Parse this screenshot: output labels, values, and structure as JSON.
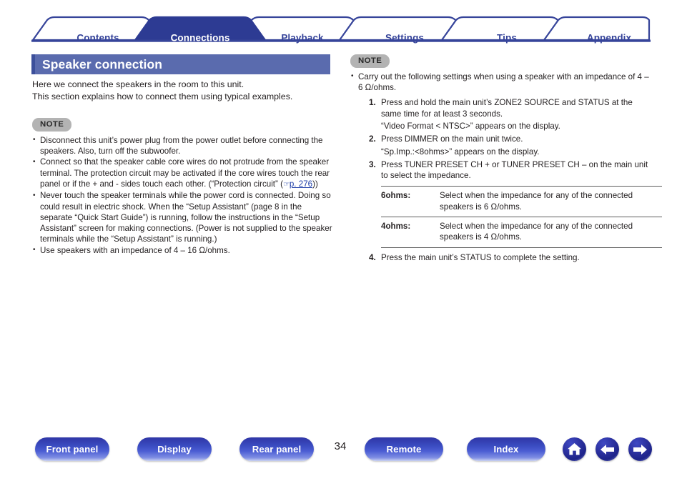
{
  "tabs": [
    {
      "label": "Contents",
      "active": false
    },
    {
      "label": "Connections",
      "active": true
    },
    {
      "label": "Playback",
      "active": false
    },
    {
      "label": "Settings",
      "active": false
    },
    {
      "label": "Tips",
      "active": false
    },
    {
      "label": "Appendix",
      "active": false
    }
  ],
  "page": {
    "title": "Speaker connection",
    "number": "34"
  },
  "left": {
    "intro": [
      "Here we connect the speakers in the room to this unit.",
      "This section explains how to connect them using typical examples."
    ],
    "note_label": "NOTE",
    "notes": [
      "Disconnect this unit’s power plug from the power outlet before connecting the speakers. Also, turn off the subwoofer.",
      "Connect so that the speaker cable core wires do not protrude from the speaker terminal. The protection circuit may be activated if the core wires touch the rear panel or if the + and - sides touch each other. (“Protection circuit” (",
      "Never touch the speaker terminals while the power cord is connected. Doing so could result in electric shock. When the “Setup Assistant” (page 8 in the separate “Quick Start Guide”) is running, follow the instructions in the “Setup Assistant” screen for making connections. (Power is not supplied to the speaker terminals while the “Setup Assistant” is running.)",
      "Use speakers with an impedance of 4 – 16 Ω/ohms."
    ],
    "link": {
      "icon": "pointing-hand-icon",
      "text": "p. 276",
      "trailing": "))"
    }
  },
  "right": {
    "note_label": "NOTE",
    "note_intro": "Carry out the following settings when using a speaker with an impedance of 4 – 6 Ω/ohms.",
    "steps": [
      {
        "num": "1.",
        "text": "Press and hold the main unit’s ZONE2 SOURCE and STATUS at the same time for at least 3 seconds.",
        "sub": "“Video Format < NTSC>” appears on the display."
      },
      {
        "num": "2.",
        "text": "Press DIMMER on the main unit twice.",
        "sub": "“Sp.Imp.:<8ohms>” appears on the display."
      },
      {
        "num": "3.",
        "text": "Press TUNER PRESET CH + or TUNER PRESET CH – on the main unit to select the impedance.",
        "sub": ""
      },
      {
        "num": "4.",
        "text": "Press the main unit’s STATUS to complete the setting.",
        "sub": ""
      }
    ],
    "table": {
      "rows": [
        {
          "key": "6ohms:",
          "value": "Select when the impedance for any of the connected speakers is 6 Ω/ohms."
        },
        {
          "key": "4ohms:",
          "value": "Select when the impedance for any of the connected speakers is 4 Ω/ohms."
        }
      ]
    }
  },
  "bottom": {
    "buttons": [
      {
        "label": "Front panel"
      },
      {
        "label": "Display"
      },
      {
        "label": "Rear panel"
      },
      {
        "label": "Remote"
      },
      {
        "label": "Index"
      }
    ],
    "icons": [
      {
        "name": "home-icon"
      },
      {
        "name": "arrow-left-icon"
      },
      {
        "name": "arrow-right-icon"
      }
    ]
  },
  "colors": {
    "tab_blue": "#36449a",
    "tab_active_fill": "#2d3b93",
    "title_bar": "#5a6bae",
    "title_accent": "#3c4f9b",
    "note_badge": "#b3b3b3",
    "link_blue": "#1f3fa8",
    "button_blue": "#3a4bc0"
  }
}
